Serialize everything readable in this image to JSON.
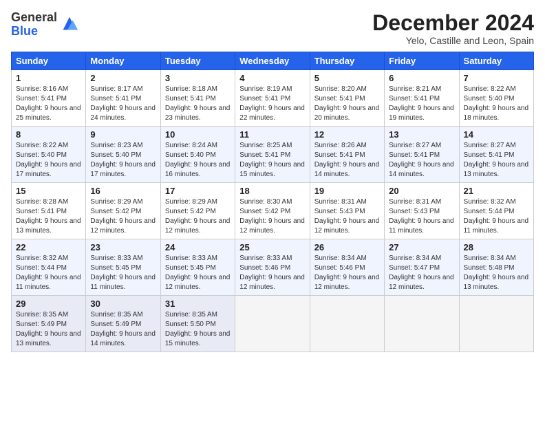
{
  "logo": {
    "general": "General",
    "blue": "Blue"
  },
  "title": "December 2024",
  "location": "Yelo, Castille and Leon, Spain",
  "headers": [
    "Sunday",
    "Monday",
    "Tuesday",
    "Wednesday",
    "Thursday",
    "Friday",
    "Saturday"
  ],
  "weeks": [
    [
      {
        "day": "1",
        "sunrise": "Sunrise: 8:16 AM",
        "sunset": "Sunset: 5:41 PM",
        "daylight": "Daylight: 9 hours and 25 minutes."
      },
      {
        "day": "2",
        "sunrise": "Sunrise: 8:17 AM",
        "sunset": "Sunset: 5:41 PM",
        "daylight": "Daylight: 9 hours and 24 minutes."
      },
      {
        "day": "3",
        "sunrise": "Sunrise: 8:18 AM",
        "sunset": "Sunset: 5:41 PM",
        "daylight": "Daylight: 9 hours and 23 minutes."
      },
      {
        "day": "4",
        "sunrise": "Sunrise: 8:19 AM",
        "sunset": "Sunset: 5:41 PM",
        "daylight": "Daylight: 9 hours and 22 minutes."
      },
      {
        "day": "5",
        "sunrise": "Sunrise: 8:20 AM",
        "sunset": "Sunset: 5:41 PM",
        "daylight": "Daylight: 9 hours and 20 minutes."
      },
      {
        "day": "6",
        "sunrise": "Sunrise: 8:21 AM",
        "sunset": "Sunset: 5:41 PM",
        "daylight": "Daylight: 9 hours and 19 minutes."
      },
      {
        "day": "7",
        "sunrise": "Sunrise: 8:22 AM",
        "sunset": "Sunset: 5:40 PM",
        "daylight": "Daylight: 9 hours and 18 minutes."
      }
    ],
    [
      {
        "day": "8",
        "sunrise": "Sunrise: 8:22 AM",
        "sunset": "Sunset: 5:40 PM",
        "daylight": "Daylight: 9 hours and 17 minutes."
      },
      {
        "day": "9",
        "sunrise": "Sunrise: 8:23 AM",
        "sunset": "Sunset: 5:40 PM",
        "daylight": "Daylight: 9 hours and 17 minutes."
      },
      {
        "day": "10",
        "sunrise": "Sunrise: 8:24 AM",
        "sunset": "Sunset: 5:40 PM",
        "daylight": "Daylight: 9 hours and 16 minutes."
      },
      {
        "day": "11",
        "sunrise": "Sunrise: 8:25 AM",
        "sunset": "Sunset: 5:41 PM",
        "daylight": "Daylight: 9 hours and 15 minutes."
      },
      {
        "day": "12",
        "sunrise": "Sunrise: 8:26 AM",
        "sunset": "Sunset: 5:41 PM",
        "daylight": "Daylight: 9 hours and 14 minutes."
      },
      {
        "day": "13",
        "sunrise": "Sunrise: 8:27 AM",
        "sunset": "Sunset: 5:41 PM",
        "daylight": "Daylight: 9 hours and 14 minutes."
      },
      {
        "day": "14",
        "sunrise": "Sunrise: 8:27 AM",
        "sunset": "Sunset: 5:41 PM",
        "daylight": "Daylight: 9 hours and 13 minutes."
      }
    ],
    [
      {
        "day": "15",
        "sunrise": "Sunrise: 8:28 AM",
        "sunset": "Sunset: 5:41 PM",
        "daylight": "Daylight: 9 hours and 13 minutes."
      },
      {
        "day": "16",
        "sunrise": "Sunrise: 8:29 AM",
        "sunset": "Sunset: 5:42 PM",
        "daylight": "Daylight: 9 hours and 12 minutes."
      },
      {
        "day": "17",
        "sunrise": "Sunrise: 8:29 AM",
        "sunset": "Sunset: 5:42 PM",
        "daylight": "Daylight: 9 hours and 12 minutes."
      },
      {
        "day": "18",
        "sunrise": "Sunrise: 8:30 AM",
        "sunset": "Sunset: 5:42 PM",
        "daylight": "Daylight: 9 hours and 12 minutes."
      },
      {
        "day": "19",
        "sunrise": "Sunrise: 8:31 AM",
        "sunset": "Sunset: 5:43 PM",
        "daylight": "Daylight: 9 hours and 12 minutes."
      },
      {
        "day": "20",
        "sunrise": "Sunrise: 8:31 AM",
        "sunset": "Sunset: 5:43 PM",
        "daylight": "Daylight: 9 hours and 11 minutes."
      },
      {
        "day": "21",
        "sunrise": "Sunrise: 8:32 AM",
        "sunset": "Sunset: 5:44 PM",
        "daylight": "Daylight: 9 hours and 11 minutes."
      }
    ],
    [
      {
        "day": "22",
        "sunrise": "Sunrise: 8:32 AM",
        "sunset": "Sunset: 5:44 PM",
        "daylight": "Daylight: 9 hours and 11 minutes."
      },
      {
        "day": "23",
        "sunrise": "Sunrise: 8:33 AM",
        "sunset": "Sunset: 5:45 PM",
        "daylight": "Daylight: 9 hours and 11 minutes."
      },
      {
        "day": "24",
        "sunrise": "Sunrise: 8:33 AM",
        "sunset": "Sunset: 5:45 PM",
        "daylight": "Daylight: 9 hours and 12 minutes."
      },
      {
        "day": "25",
        "sunrise": "Sunrise: 8:33 AM",
        "sunset": "Sunset: 5:46 PM",
        "daylight": "Daylight: 9 hours and 12 minutes."
      },
      {
        "day": "26",
        "sunrise": "Sunrise: 8:34 AM",
        "sunset": "Sunset: 5:46 PM",
        "daylight": "Daylight: 9 hours and 12 minutes."
      },
      {
        "day": "27",
        "sunrise": "Sunrise: 8:34 AM",
        "sunset": "Sunset: 5:47 PM",
        "daylight": "Daylight: 9 hours and 12 minutes."
      },
      {
        "day": "28",
        "sunrise": "Sunrise: 8:34 AM",
        "sunset": "Sunset: 5:48 PM",
        "daylight": "Daylight: 9 hours and 13 minutes."
      }
    ],
    [
      {
        "day": "29",
        "sunrise": "Sunrise: 8:35 AM",
        "sunset": "Sunset: 5:49 PM",
        "daylight": "Daylight: 9 hours and 13 minutes."
      },
      {
        "day": "30",
        "sunrise": "Sunrise: 8:35 AM",
        "sunset": "Sunset: 5:49 PM",
        "daylight": "Daylight: 9 hours and 14 minutes."
      },
      {
        "day": "31",
        "sunrise": "Sunrise: 8:35 AM",
        "sunset": "Sunset: 5:50 PM",
        "daylight": "Daylight: 9 hours and 15 minutes."
      },
      null,
      null,
      null,
      null
    ]
  ]
}
